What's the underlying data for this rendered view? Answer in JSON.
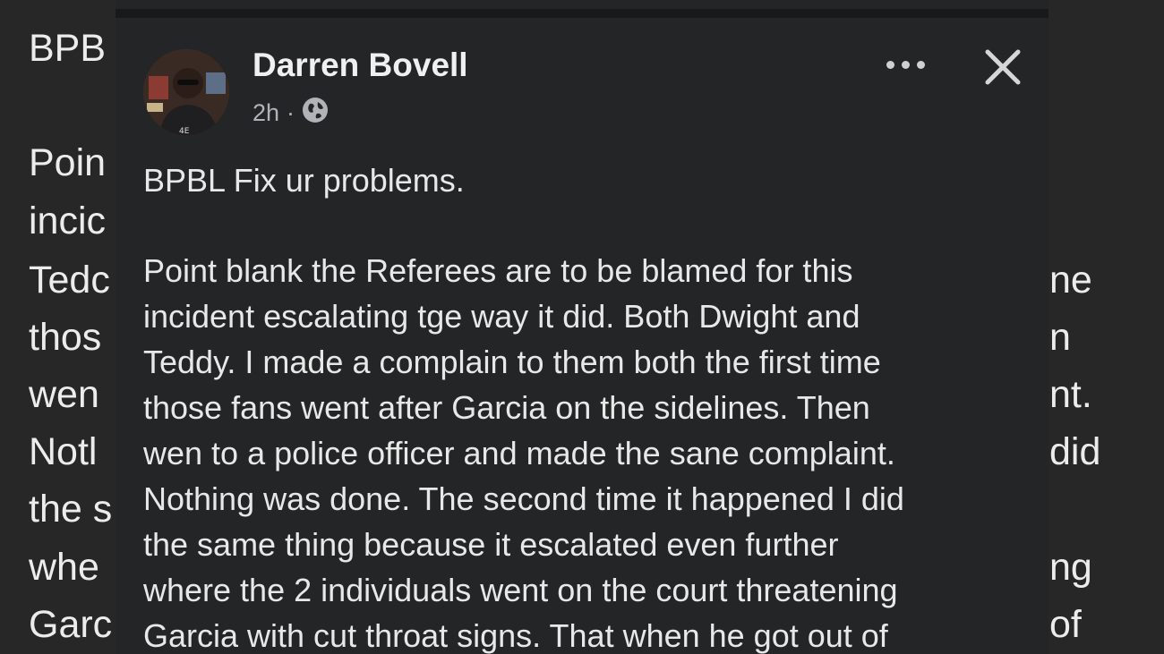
{
  "background_post": {
    "left_fragments": [
      "BPB",
      "Poin",
      "incic",
      "Tedc",
      "thos",
      "wen",
      "Notl",
      "the s",
      "whe",
      "Garc"
    ],
    "right_fragments": [
      "ne",
      "n",
      "nt.",
      "did",
      "ng",
      "of"
    ]
  },
  "post": {
    "author": "Darren Bovell",
    "time": "2h",
    "separator": "·",
    "audience_icon": "globe-icon",
    "headline": "BPBL Fix ur problems.",
    "lines": [
      "Point blank the Referees are to be blamed for this",
      "incident escalating tge way it did. Both Dwight and",
      "Teddy. I made a complain to them both the first time",
      "those fans went after Garcia on the sidelines.  Then",
      "wen to a police officer and made the sane complaint.",
      "Nothing was done. The second time it happened I did",
      "the same thing because it escalated even further",
      "where the 2 individuals went on the court threatening",
      "Garcia with cut throat signs. That when he got out of"
    ]
  },
  "toolbar": {
    "more_icon": "more-options-icon",
    "close_icon": "close-icon"
  },
  "colors": {
    "background": "#272727",
    "modal": "#242526",
    "text": "#e8e8e8",
    "meta": "#b0b3b8"
  }
}
